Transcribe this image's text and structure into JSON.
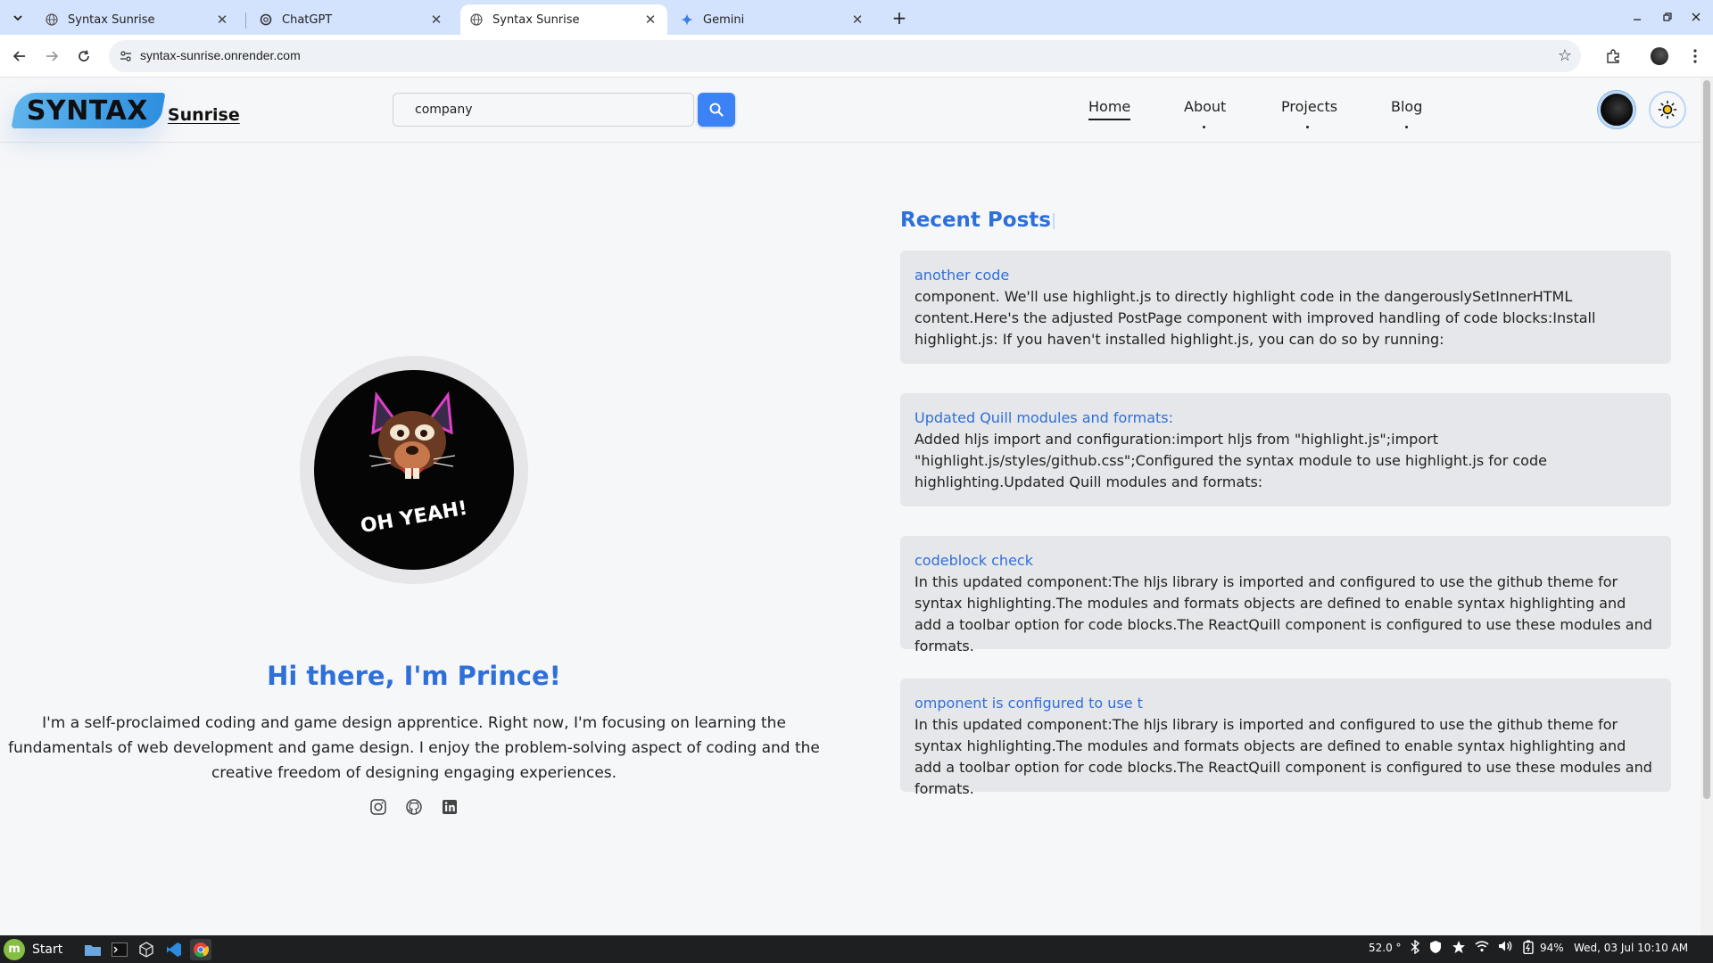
{
  "browser": {
    "tabs": [
      {
        "title": "Syntax Sunrise",
        "active": false
      },
      {
        "title": "ChatGPT",
        "active": false
      },
      {
        "title": "Syntax Sunrise",
        "active": true
      },
      {
        "title": "Gemini",
        "active": false
      }
    ],
    "url": "syntax-sunrise.onrender.com"
  },
  "site": {
    "logo_main": "SYNTAX",
    "logo_sub": "Sunrise",
    "search": {
      "value": "company"
    },
    "nav": [
      {
        "label": "Home",
        "active": true
      },
      {
        "label": "About",
        "active": false
      },
      {
        "label": "Projects",
        "active": false
      },
      {
        "label": "Blog",
        "active": false
      }
    ]
  },
  "profile": {
    "avatar_text": "OH YEAH!",
    "title": "Hi there, I'm Prince!",
    "bio": "I'm a self-proclaimed coding and game design apprentice. Right now, I'm focusing on learning the fundamentals of web development and game design. I enjoy the problem-solving aspect of coding and the creative freedom of designing engaging experiences.",
    "socials": [
      "instagram-icon",
      "github-icon",
      "linkedin-icon"
    ]
  },
  "posts": {
    "heading": "Recent Posts",
    "items": [
      {
        "title": "another code",
        "body": "component. We'll use highlight.js to directly highlight code in the dangerouslySetInnerHTML content.Here's the adjusted PostPage component with improved handling of code blocks:Install highlight.js: If you haven't installed highlight.js, you can do so by running:"
      },
      {
        "title": "Updated Quill modules and formats:",
        "body": "Added hljs import and configuration:import hljs from \"highlight.js\";import \"highlight.js/styles/github.css\";Configured the syntax module to use highlight.js for code highlighting.Updated Quill modules and formats:"
      },
      {
        "title": "codeblock check",
        "body": "In this updated component:The hljs library is imported and configured to use the github theme for syntax highlighting.The modules and formats objects are defined to enable syntax highlighting and add a toolbar option for code blocks.The ReactQuill component is configured to use these modules and formats."
      },
      {
        "title": "omponent is configured to use t",
        "body": "In this updated component:The hljs library is imported and configured to use the github theme for syntax highlighting.The modules and formats objects are defined to enable syntax highlighting and add a toolbar option for code blocks.The ReactQuill component is configured to use these modules and formats."
      }
    ]
  },
  "taskbar": {
    "start_label": "Start",
    "temperature": "52.0 °",
    "battery": "94%",
    "datetime": "Wed, 03 Jul 10:10 AM"
  },
  "colors": {
    "accent": "#2f6fd8",
    "search_button": "#3b82f6",
    "logo_gradient": "#2e8fe0",
    "card_bg": "#e6e7ea"
  }
}
